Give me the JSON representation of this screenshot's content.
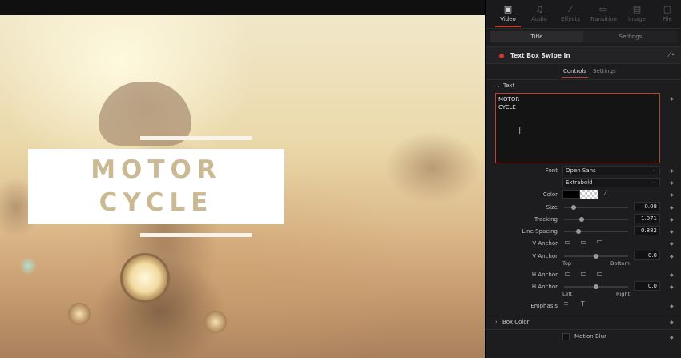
{
  "viewer": {
    "title_lines": [
      "MOTOR",
      "CYCLE"
    ]
  },
  "inspector": {
    "tabs": [
      {
        "label": "Video",
        "icon": "video-icon",
        "active": true
      },
      {
        "label": "Audio",
        "icon": "music-note-icon",
        "active": false
      },
      {
        "label": "Effects",
        "icon": "magic-wand-icon",
        "active": false
      },
      {
        "label": "Transition",
        "icon": "transition-icon",
        "active": false
      },
      {
        "label": "Image",
        "icon": "image-icon",
        "active": false
      },
      {
        "label": "File",
        "icon": "file-icon",
        "active": false
      }
    ],
    "subtabs": [
      {
        "label": "Title",
        "active": true
      },
      {
        "label": "Settings",
        "active": false
      }
    ],
    "effect": {
      "name": "Text Box Swipe In",
      "status_color": "#d5332c",
      "tabs": [
        {
          "label": "Controls",
          "active": true
        },
        {
          "label": "Settings",
          "active": false
        }
      ]
    },
    "text_section": {
      "title": "Text",
      "text_value": "MOTOR\nCYCLE",
      "font": {
        "label": "Font",
        "value": "Open Sans"
      },
      "style_value": "Extrabold",
      "color_label": "Color",
      "size": {
        "label": "Size",
        "value": "0.08",
        "fraction": 0.15
      },
      "tracking": {
        "label": "Tracking",
        "value": "1.071",
        "fraction": 0.27
      },
      "line_spacing": {
        "label": "Line Spacing",
        "value": "0.882",
        "fraction": 0.22
      },
      "v_anchor_label": "V Anchor",
      "v_anchor": {
        "label": "V Anchor",
        "value": "0.0",
        "fraction": 0.5,
        "start": "Top",
        "end": "Bottom"
      },
      "h_anchor_label": "H Anchor",
      "h_anchor": {
        "label": "H Anchor",
        "value": "0.0",
        "fraction": 0.5,
        "start": "Left",
        "end": "Right"
      },
      "emphasis_label": "Emphasis"
    },
    "box_color_section": {
      "title": "Box Color"
    },
    "motion_blur": {
      "label": "Motion Blur",
      "checked": false
    },
    "accent_color": "#c8372d"
  }
}
